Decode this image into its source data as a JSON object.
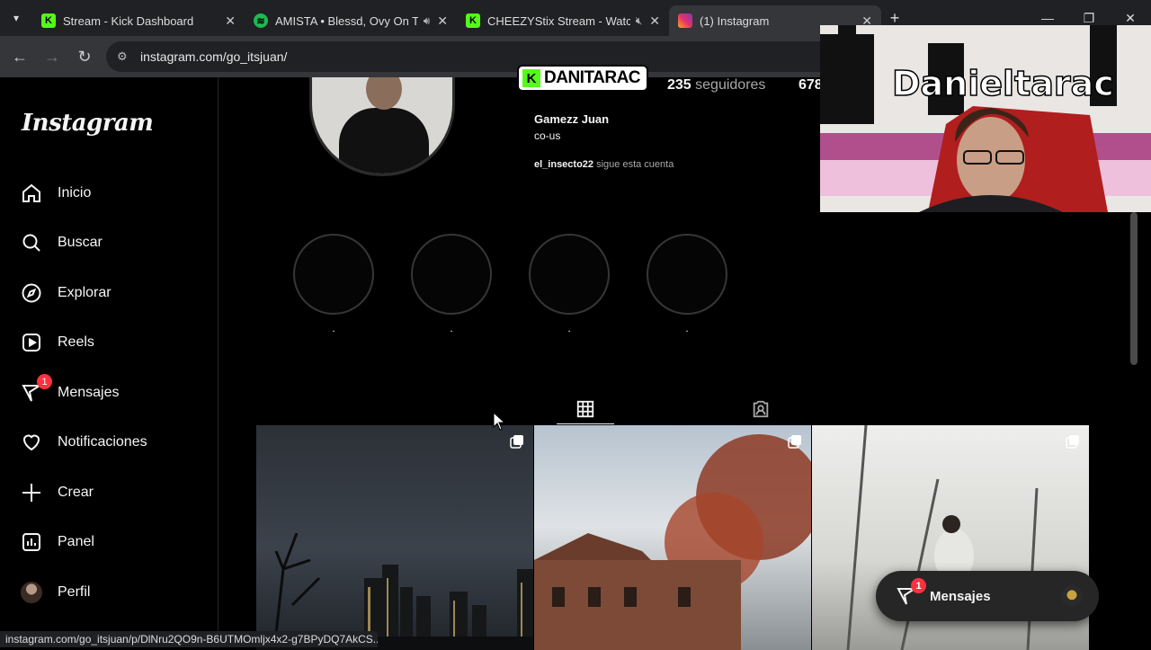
{
  "browser": {
    "tabs": [
      {
        "title": "Stream - Kick Dashboard",
        "favicon": "kick-icon",
        "color": "#53fc18"
      },
      {
        "title": "AMISTA • Blessd, Ovy On Th",
        "favicon": "spotify-icon",
        "color": "#1db954"
      },
      {
        "title": "CHEEZYStix Stream - Watch",
        "favicon": "kick-icon",
        "color": "#53fc18"
      },
      {
        "title": "(1) Instagram",
        "favicon": "instagram-icon",
        "color": "#e1306c"
      }
    ],
    "url": "instagram.com/go_itsjuan/",
    "status_url": "instagram.com/go_itsjuan/p/DlNru2QO9n-B6UTMOmljx4x2-g7BPyDQ7AkCS..."
  },
  "instagram": {
    "logo": "Instagram",
    "nav": [
      {
        "label": "Inicio",
        "icon": "home-icon"
      },
      {
        "label": "Buscar",
        "icon": "search-icon"
      },
      {
        "label": "Explorar",
        "icon": "compass-icon"
      },
      {
        "label": "Reels",
        "icon": "reels-icon"
      },
      {
        "label": "Mensajes",
        "icon": "messenger-icon",
        "badge": "1"
      },
      {
        "label": "Notificaciones",
        "icon": "heart-icon"
      },
      {
        "label": "Crear",
        "icon": "plus-icon"
      },
      {
        "label": "Panel",
        "icon": "chart-icon"
      },
      {
        "label": "Perfil",
        "icon": "avatar"
      }
    ],
    "profile": {
      "followers_count": "235",
      "followers_label": "seguidores",
      "following_count": "678",
      "full_name": "Gamezz Juan",
      "bio": "co-us",
      "followed_by_user": "el_insecto22",
      "followed_by_text": "sigue esta cuenta"
    },
    "highlights": [
      ".",
      ".",
      ".",
      "."
    ],
    "messages_pill": {
      "label": "Mensajes",
      "badge": "1"
    }
  },
  "stream_overlay": {
    "streamer_name": "DANITARAC",
    "cam_text": "Danieltarac"
  }
}
